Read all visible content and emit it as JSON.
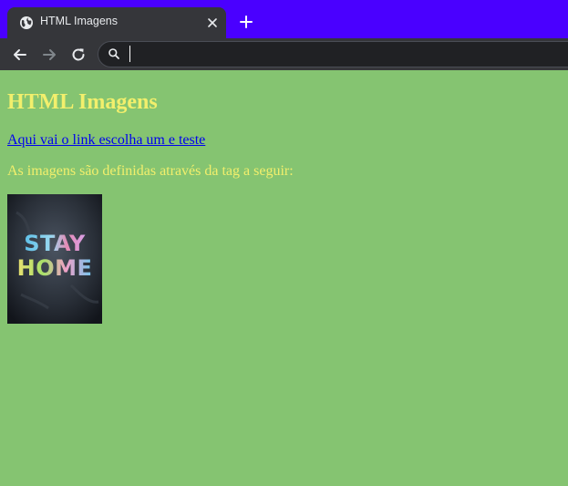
{
  "browser": {
    "tab_title": "HTML Imagens",
    "address_value": "",
    "colors": {
      "tabstrip": "#4a00ff",
      "toolbar": "#35363a",
      "page_background": "#85c471",
      "heading_text": "#f2ef6c",
      "link": "#0000ee"
    },
    "icons": {
      "tab": "globe-icon",
      "tab_close": "close-icon",
      "new_tab": "plus-icon",
      "back": "arrow-left-icon",
      "forward": "arrow-right-icon",
      "reload": "reload-icon",
      "omnibox": "search-icon"
    }
  },
  "page": {
    "heading": "HTML Imagens",
    "link_text": "Aqui vai o link escolha um e teste",
    "paragraph": "As imagens são definidas através da tag a seguir:",
    "image": {
      "text_line1": "STAY",
      "text_line2": "HOME"
    }
  }
}
